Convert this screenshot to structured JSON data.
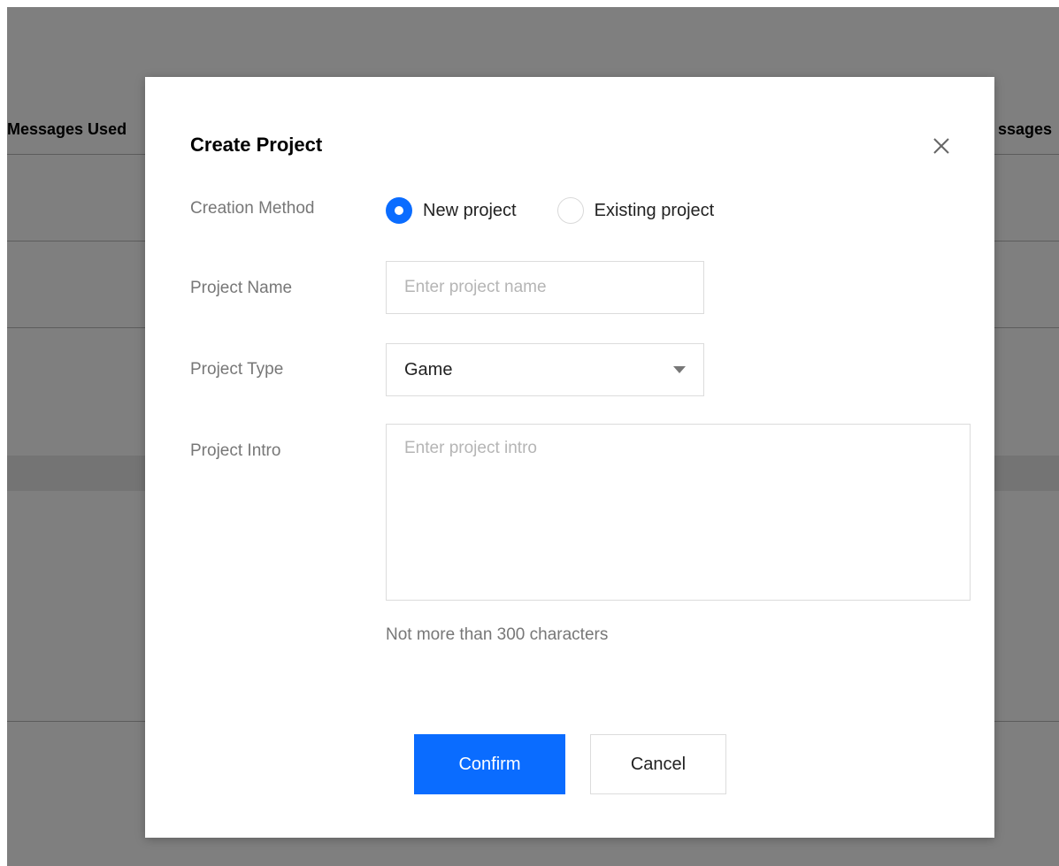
{
  "background": {
    "header_left": "Messages Used",
    "header_right": "ssages"
  },
  "modal": {
    "title": "Create Project",
    "close_icon": "close-icon",
    "creation_method": {
      "label": "Creation Method",
      "options": [
        {
          "label": "New project",
          "checked": true
        },
        {
          "label": "Existing project",
          "checked": false
        }
      ]
    },
    "project_name": {
      "label": "Project Name",
      "value": "",
      "placeholder": "Enter project name"
    },
    "project_type": {
      "label": "Project Type",
      "value": "Game",
      "caret_icon": "caret-down-icon"
    },
    "project_intro": {
      "label": "Project Intro",
      "value": "",
      "placeholder": "Enter project intro",
      "hint": "Not more than 300 characters"
    },
    "buttons": {
      "confirm": "Confirm",
      "cancel": "Cancel"
    }
  },
  "colors": {
    "primary": "#0a6cff",
    "overlay": "rgba(0,0,0,0.5)"
  }
}
